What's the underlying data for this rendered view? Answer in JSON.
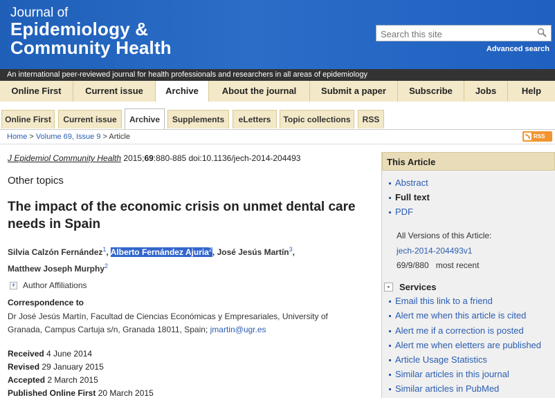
{
  "header": {
    "logo_line1": "Journal of",
    "logo_line2": "Epidemiology &",
    "logo_line3": "Community Health",
    "search_placeholder": "Search this site",
    "advanced_search": "Advanced search",
    "tagline": "An international peer-reviewed journal for health professionals and researchers in all areas of epidemiology"
  },
  "main_nav": [
    {
      "label": "Online First"
    },
    {
      "label": "Current issue"
    },
    {
      "label": "Archive"
    },
    {
      "label": "About the journal"
    },
    {
      "label": "Submit a paper"
    },
    {
      "label": "Subscribe"
    },
    {
      "label": "Jobs"
    },
    {
      "label": "Help"
    }
  ],
  "sub_tabs": [
    {
      "label": "Online First"
    },
    {
      "label": "Current issue"
    },
    {
      "label": "Archive"
    },
    {
      "label": "Supplements"
    },
    {
      "label": "eLetters"
    },
    {
      "label": "Topic collections"
    },
    {
      "label": "RSS"
    }
  ],
  "breadcrumb": {
    "home": "Home",
    "sep1": ">",
    "volume": "Volume 69, Issue 9",
    "sep2": ">",
    "current": "Article"
  },
  "rss_badge": "RSS",
  "article": {
    "journal_abbr": "J Epidemiol Community Health",
    "year": " 2015;",
    "volume": "69",
    "pages_doi": ":880-885 doi:10.1136/jech-2014-204493",
    "section": "Other topics",
    "title": "The impact of the economic crisis on unmet dental care needs in Spain",
    "authors": [
      {
        "name": "Silvia Calzón Fernández",
        "sup": "1"
      },
      {
        "name": "Alberto Fernández Ajuria",
        "sup": "2"
      },
      {
        "name": "José Jesús Martín",
        "sup": "3"
      },
      {
        "name": "Matthew Joseph Murphy",
        "sup": "2"
      }
    ],
    "affiliations_label": "Author Affiliations",
    "correspondence_heading": "Correspondence to",
    "correspondence_text": "Dr José Jesús Martín, Facultad de Ciencias Económicas y Empresariales, University of Granada, Campus Cartuja s/n, Granada 18011, Spain; ",
    "correspondence_email": "jmartin@ugr.es",
    "dates": [
      {
        "label": "Received",
        "value": " 4 June 2014"
      },
      {
        "label": "Revised",
        "value": " 29 January 2015"
      },
      {
        "label": "Accepted",
        "value": " 2 March 2015"
      },
      {
        "label": "Published Online First",
        "value": " 20 March 2015"
      }
    ]
  },
  "sidebar": {
    "heading": "This Article",
    "items": [
      {
        "label": "Abstract"
      },
      {
        "label": "Full text"
      },
      {
        "label": "PDF"
      }
    ],
    "versions_label": "All Versions of this Article:",
    "version_link": "jech-2014-204493v1",
    "version_info": "69/9/880",
    "version_status": "most recent",
    "services_heading": "Services",
    "services": [
      {
        "label": "Email this link to a friend"
      },
      {
        "label": "Alert me when this article is cited"
      },
      {
        "label": "Alert me if a correction is posted"
      },
      {
        "label": "Alert me when eletters are published"
      },
      {
        "label": "Article Usage Statistics"
      },
      {
        "label": "Similar articles in this journal"
      },
      {
        "label": "Similar articles in PubMed"
      }
    ]
  }
}
